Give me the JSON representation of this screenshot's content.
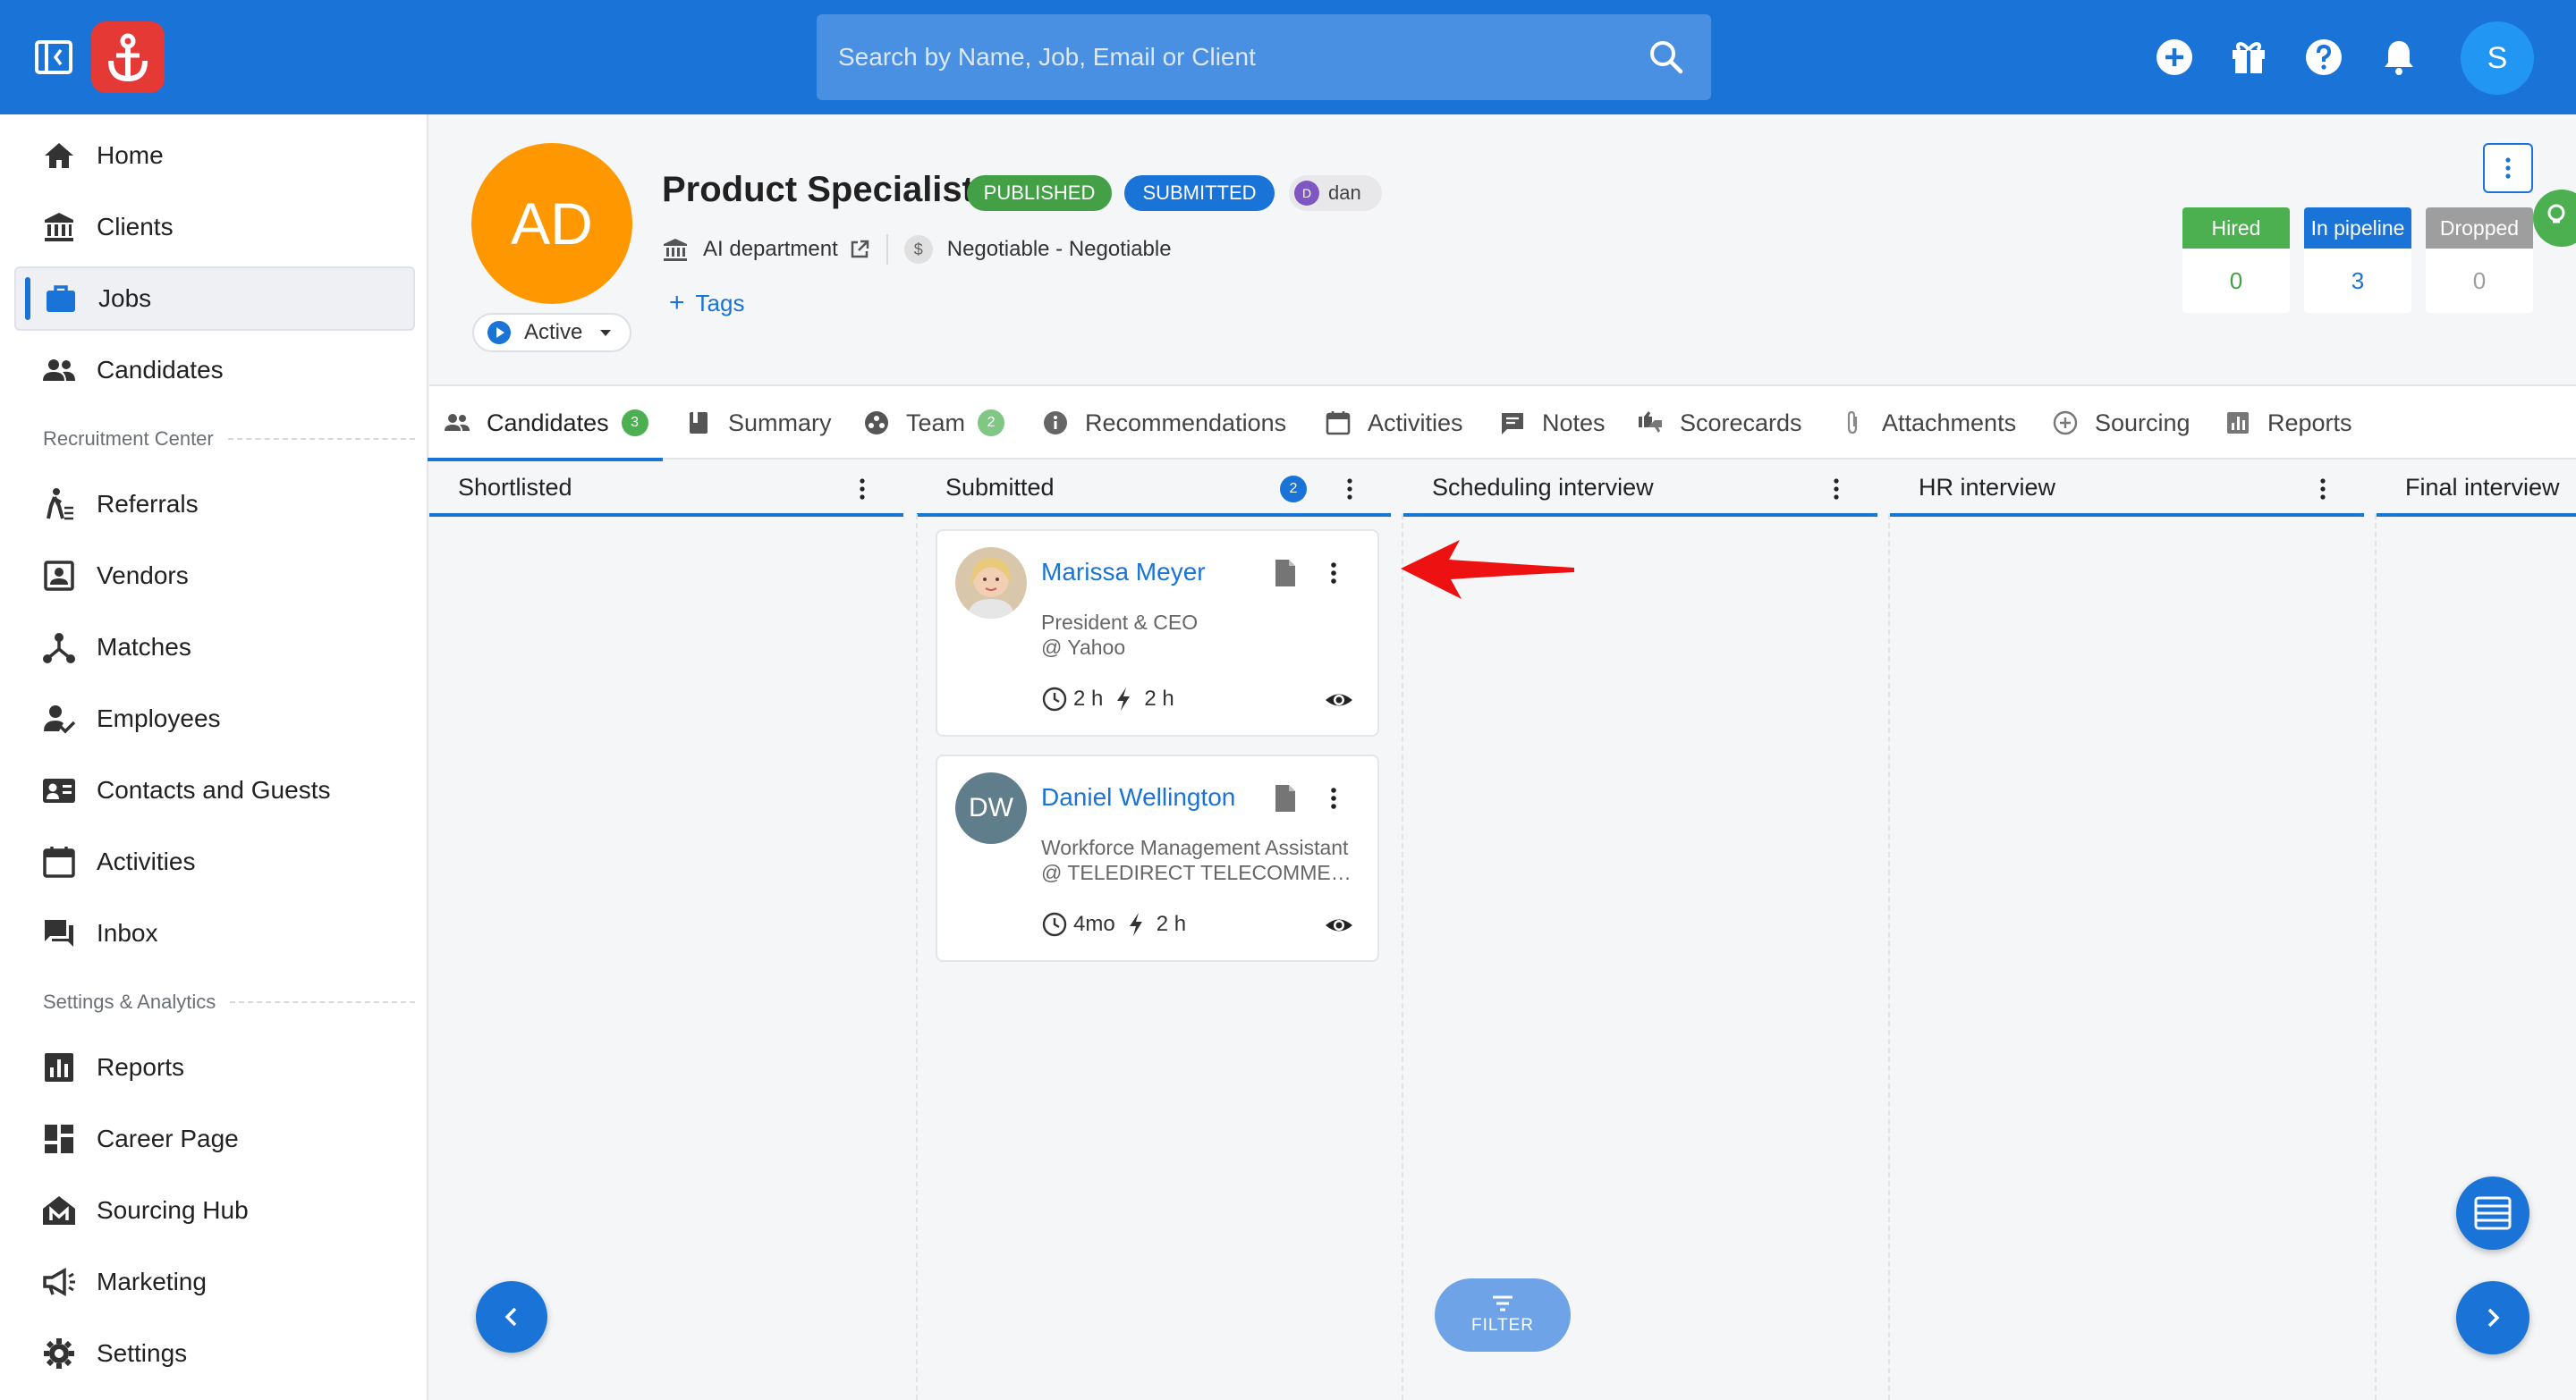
{
  "search": {
    "placeholder": "Search by Name, Job, Email or Client"
  },
  "user": {
    "avatar_initial": "S"
  },
  "sidebar": {
    "items": [
      {
        "label": "Home",
        "icon": "home-icon"
      },
      {
        "label": "Clients",
        "icon": "bank-icon"
      },
      {
        "label": "Jobs",
        "icon": "briefcase-icon",
        "active": true
      },
      {
        "label": "Candidates",
        "icon": "people-icon"
      },
      {
        "label": "Referrals",
        "icon": "walking-person-icon"
      },
      {
        "label": "Vendors",
        "icon": "contact-card-icon"
      },
      {
        "label": "Matches",
        "icon": "network-icon"
      },
      {
        "label": "Employees",
        "icon": "person-check-icon"
      },
      {
        "label": "Contacts and Guests",
        "icon": "contacts-icon"
      },
      {
        "label": "Activities",
        "icon": "calendar-icon"
      },
      {
        "label": "Inbox",
        "icon": "chat-icon"
      },
      {
        "label": "Reports",
        "icon": "bar-chart-icon"
      },
      {
        "label": "Career Page",
        "icon": "dashboard-icon"
      },
      {
        "label": "Sourcing Hub",
        "icon": "sourcing-hub-icon"
      },
      {
        "label": "Marketing",
        "icon": "megaphone-icon"
      },
      {
        "label": "Settings",
        "icon": "gear-icon"
      }
    ],
    "sections": {
      "recruitment": "Recruitment Center",
      "settings": "Settings & Analytics"
    }
  },
  "job": {
    "avatar_initials": "AD",
    "title": "Product Specialist",
    "status_chips": {
      "published": "PUBLISHED",
      "submitted": "SUBMITTED"
    },
    "owner": {
      "initial": "D",
      "name": "dan"
    },
    "department": "AI department",
    "salary": "Negotiable - Negotiable",
    "currency_symbol": "$",
    "tags_label": "Tags",
    "status_select": "Active"
  },
  "stats": {
    "hired": {
      "label": "Hired",
      "value": "0"
    },
    "in_pipeline": {
      "label": "In pipeline",
      "value": "3"
    },
    "dropped": {
      "label": "Dropped",
      "value": "0"
    }
  },
  "tabs": [
    {
      "label": "Candidates",
      "count": "3",
      "icon": "people-icon",
      "active": true
    },
    {
      "label": "Summary",
      "icon": "book-icon"
    },
    {
      "label": "Team",
      "count": "2",
      "icon": "team-icon"
    },
    {
      "label": "Recommendations",
      "icon": "info-icon"
    },
    {
      "label": "Activities",
      "icon": "calendar-icon"
    },
    {
      "label": "Notes",
      "icon": "note-icon"
    },
    {
      "label": "Scorecards",
      "icon": "thumbs-icon"
    },
    {
      "label": "Attachments",
      "icon": "paperclip-icon"
    },
    {
      "label": "Sourcing",
      "icon": "add-circle-icon"
    },
    {
      "label": "Reports",
      "icon": "bar-chart-icon"
    }
  ],
  "pipeline": {
    "columns": [
      {
        "title": "Shortlisted"
      },
      {
        "title": "Submitted",
        "count": "2"
      },
      {
        "title": "Scheduling interview"
      },
      {
        "title": "HR interview"
      },
      {
        "title": "Final interview"
      }
    ],
    "candidates": [
      {
        "name": "Marissa Meyer",
        "role_line1": "President & CEO",
        "role_line2": "@ Yahoo",
        "time_in_stage": "2 h",
        "last_activity": "2 h",
        "has_photo": true
      },
      {
        "name": "Daniel Wellington",
        "initials": "DW",
        "role_line1": "Workforce Management Assistant",
        "role_line2": "@ TELEDIRECT TELECOMMERCE",
        "time_in_stage": "4mo",
        "last_activity": "2 h",
        "has_photo": false
      }
    ]
  },
  "filter": {
    "label": "FILTER"
  },
  "colors": {
    "primary": "#1a73d6",
    "published": "#43a047",
    "job_avatar": "#ff9800",
    "logo": "#e53935",
    "annotation_arrow": "#ee1111"
  }
}
